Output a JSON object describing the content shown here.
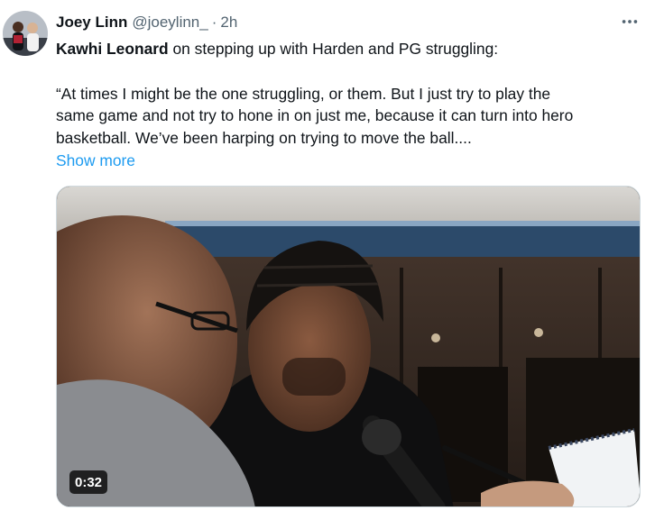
{
  "author": {
    "display_name": "Joey Linn",
    "handle": "@joeylinn_",
    "separator": "·",
    "time": "2h",
    "avatar_icon": "user-avatar"
  },
  "menu": {
    "icon": "more-horizontal-icon"
  },
  "body": {
    "mention": "Kawhi Leonard",
    "lead": " on stepping up with Harden and PG struggling:",
    "quote_lines": [
      "“At times I might be the one struggling, or them. But I just try to play the",
      "same game and not try to hone in on just me, because it can turn into hero",
      "basketball. We’ve been harping on trying to move the ball...."
    ],
    "show_more": "Show more"
  },
  "media": {
    "type": "video",
    "duration": "0:32"
  },
  "colors": {
    "link": "#1d9bf0",
    "secondary": "#536471",
    "text": "#0f1419"
  }
}
